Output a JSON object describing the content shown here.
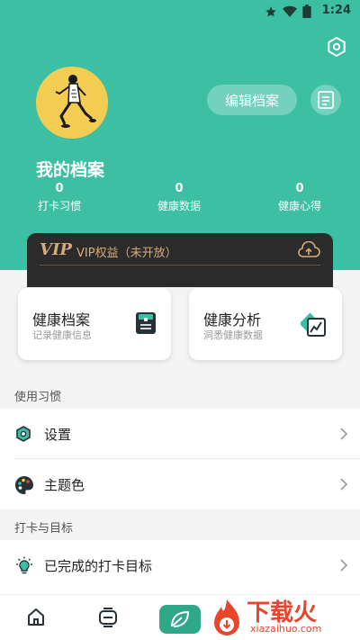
{
  "status_bar": {
    "time": "1:24"
  },
  "profile": {
    "edit_label": "编辑档案",
    "title": "我的档案"
  },
  "stats": [
    {
      "value": "0",
      "label": "打卡习惯"
    },
    {
      "value": "0",
      "label": "健康数据"
    },
    {
      "value": "0",
      "label": "健康心得"
    }
  ],
  "vip": {
    "logo": "VIP",
    "text": "VIP权益（未开放）"
  },
  "features": [
    {
      "title": "健康档案",
      "subtitle": "记录健康信息"
    },
    {
      "title": "健康分析",
      "subtitle": "洞悉健康数据"
    }
  ],
  "sections": [
    {
      "label": "使用习惯",
      "items": [
        {
          "label": "设置",
          "icon": "settings-icon"
        },
        {
          "label": "主题色",
          "icon": "palette-icon"
        }
      ]
    },
    {
      "label": "打卡与目标",
      "items": [
        {
          "label": "已完成的打卡目标",
          "icon": "lightbulb-icon"
        }
      ]
    }
  ],
  "watermark": {
    "main": "下载火",
    "sub": "xiazaihuo.com"
  },
  "colors": {
    "header": "#3dbfa4",
    "accent": "#2fa88a",
    "vip_gold": "#d7ab79"
  }
}
